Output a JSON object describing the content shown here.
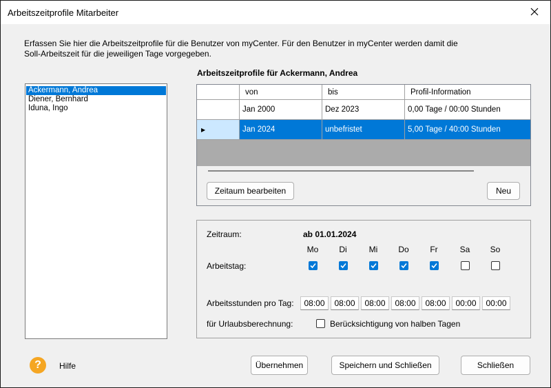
{
  "window": {
    "title": "Arbeitszeitprofile Mitarbeiter"
  },
  "description": "Erfassen Sie hier die Arbeitszeitprofile für die Benutzer von myCenter. Für den Benutzer in myCenter werden damit die Soll-Arbeitszeit für die jeweiligen Tage vorgegeben.",
  "users": [
    {
      "name": "Ackermann, Andrea",
      "selected": true
    },
    {
      "name": "Diener, Bernhard",
      "selected": false
    },
    {
      "name": "Iduna, Ingo",
      "selected": false
    }
  ],
  "profiles": {
    "title": "Arbeitszeitprofile für Ackermann, Andrea",
    "columns": [
      "",
      "von",
      "bis",
      "Profil-Information"
    ],
    "rows": [
      {
        "von": "Jan 2000",
        "bis": "Dez 2023",
        "info": "0,00 Tage / 00:00 Stunden",
        "selected": false
      },
      {
        "von": "Jan 2024",
        "bis": "unbefristet",
        "info": "5,00 Tage / 40:00 Stunden",
        "selected": true
      }
    ],
    "edit_button": "Zeitaum bearbeiten",
    "new_button": "Neu"
  },
  "settings": {
    "zeitraum_label": "Zeitraum:",
    "zeitraum_value": "ab 01.01.2024",
    "days": [
      "Mo",
      "Di",
      "Mi",
      "Do",
      "Fr",
      "Sa",
      "So"
    ],
    "arbeitstag_label": "Arbeitstag:",
    "arbeitstag": [
      true,
      true,
      true,
      true,
      true,
      false,
      false
    ],
    "stunden_label": "Arbeitsstunden pro Tag:",
    "stunden": [
      "08:00",
      "08:00",
      "08:00",
      "08:00",
      "08:00",
      "00:00",
      "00:00"
    ],
    "urlaub_label": "für Urlaubsberechnung:",
    "halbe_tage_label": "Berücksichtigung von halben Tagen",
    "halbe_tage_checked": false
  },
  "footer": {
    "help_label": "Hilfe",
    "apply_button": "Übernehmen",
    "save_close_button": "Speichern und Schließen",
    "close_button": "Schließen"
  },
  "colors": {
    "accent": "#0078d7",
    "help_icon": "#f5a623",
    "grid_empty": "#ababab"
  }
}
